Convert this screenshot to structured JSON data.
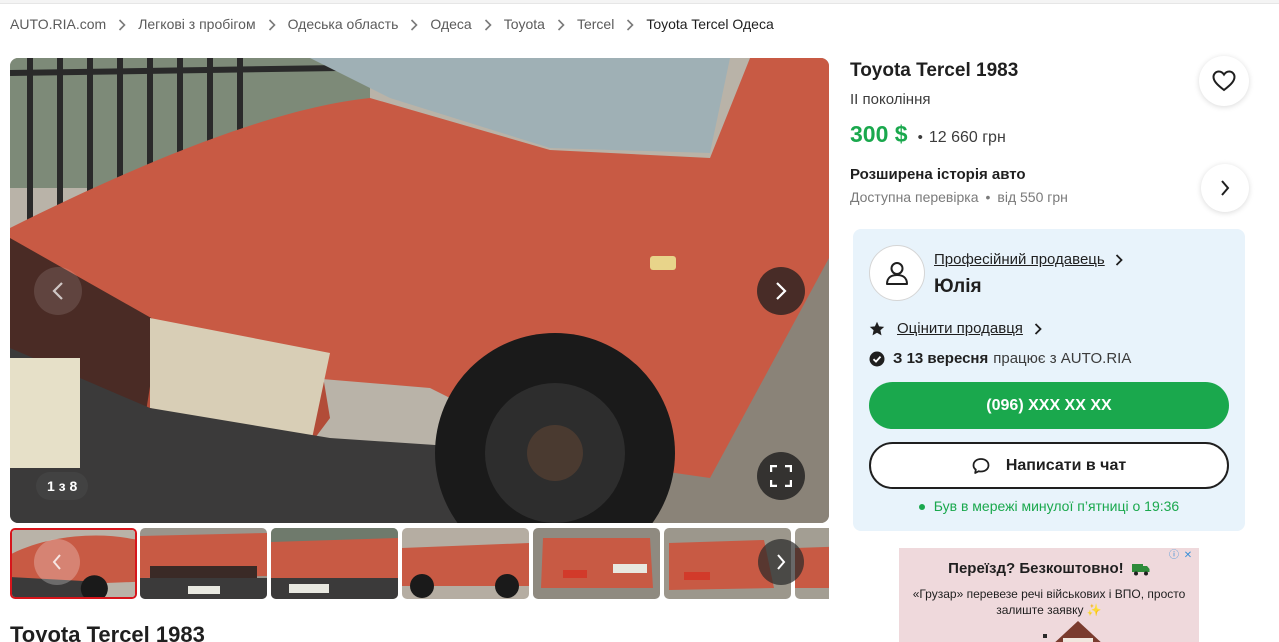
{
  "breadcrumb": {
    "items": [
      "AUTO.RIA.com",
      "Легкові з пробігом",
      "Одеська область",
      "Одеса",
      "Toyota",
      "Tercel"
    ],
    "current": "Toyota Tercel Одеса"
  },
  "gallery": {
    "counter": "1 з 8",
    "thumbnail_count": 7
  },
  "listing": {
    "title": "Toyota Tercel 1983",
    "generation": "II покоління",
    "price_usd": "300 $",
    "separator": "•",
    "price_uah": "12 660 грн"
  },
  "history": {
    "title": "Розширена історія авто",
    "subtitle": "Доступна перевірка",
    "separator": "•",
    "price": "від 550 грн"
  },
  "seller": {
    "type": "Професійний продавець",
    "name": "Юлія",
    "rate_label": "Оцінити продавця",
    "since_bold": "З 13 вересня",
    "since_rest": "працює з AUTO.RIA",
    "phone": "(096) XXX XX XX",
    "chat_label": "Написати в чат",
    "online_status": "Був в мережі минулої п’ятниці о 19:36"
  },
  "ad": {
    "title": "Переїзд? Безкоштовно!",
    "text": "«Грузар» перевезе речі військових і ВПО, просто залиште заявку ✨"
  },
  "section_title": "Toyota Tercel 1983",
  "colors": {
    "accent_green": "#1aa84d",
    "seller_card_bg": "#e8f3fb",
    "active_thumb_border": "#d6151b"
  }
}
